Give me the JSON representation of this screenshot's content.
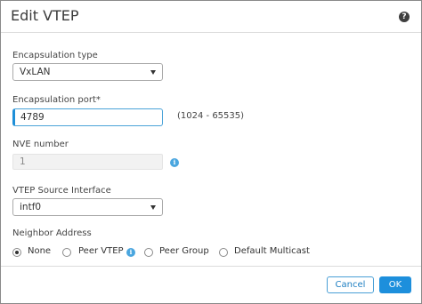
{
  "dialog": {
    "title": "Edit VTEP",
    "help_icon": "?"
  },
  "encapsulation_type": {
    "label": "Encapsulation type",
    "value": "VxLAN"
  },
  "encapsulation_port": {
    "label": "Encapsulation port*",
    "value": "4789",
    "range_hint": "(1024 - 65535)"
  },
  "nve_number": {
    "label": "NVE number",
    "value": "1",
    "info_icon": "i"
  },
  "vtep_source_interface": {
    "label": "VTEP Source Interface",
    "value": "intf0"
  },
  "neighbor_address": {
    "label": "Neighbor Address",
    "options": [
      {
        "label": "None",
        "checked": true
      },
      {
        "label": "Peer VTEP",
        "checked": false
      },
      {
        "label": "Peer Group",
        "checked": false
      },
      {
        "label": "Default Multicast",
        "checked": false
      }
    ],
    "info_icon": "i"
  },
  "footer": {
    "cancel_label": "Cancel",
    "ok_label": "OK"
  },
  "colors": {
    "accent": "#1d8fdc",
    "info": "#4aa6df"
  }
}
